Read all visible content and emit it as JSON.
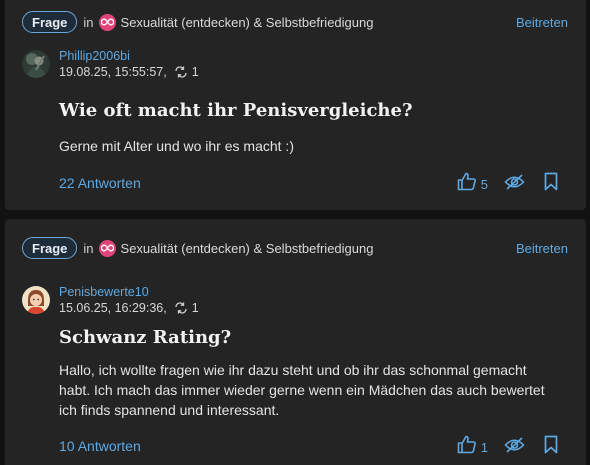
{
  "posts": [
    {
      "badge": "Frage",
      "in_word": "in",
      "category": "Sexualität (entdecken) & Selbstbefriedigung",
      "join_label": "Beitreten",
      "username": "Phillip2006bi",
      "datetime": "19.08.25, 15:55:57,",
      "repost_count": "1",
      "title": "Wie oft macht ihr Penisvergleiche?",
      "body": "Gerne mit Alter und wo ihr es macht :)",
      "answers_label": "22 Antworten",
      "like_count": "5"
    },
    {
      "badge": "Frage",
      "in_word": "in",
      "category": "Sexualität (entdecken) & Selbstbefriedigung",
      "join_label": "Beitreten",
      "username": "Penisbewerte10",
      "datetime": "15.06.25, 16:29:36,",
      "repost_count": "1",
      "title": "Schwanz Rating?",
      "body": "Hallo, ich wollte fragen wie ihr dazu steht und ob ihr das schonmal gemacht habt. Ich mach das immer wieder gerne wenn ein Mädchen das auch bewertet ich finds spannend und interessant.",
      "answers_label": "10 Antworten",
      "like_count": "1"
    }
  ],
  "colors": {
    "accent": "#5fa9e3",
    "card_bg": "#242424",
    "page_bg": "#121212",
    "category_icon": "#e0447a"
  },
  "icons": {
    "category": "infinity-icon",
    "repost": "repost-icon",
    "like": "thumbs-up-icon",
    "hide": "eye-slash-icon",
    "bookmark": "bookmark-icon"
  }
}
